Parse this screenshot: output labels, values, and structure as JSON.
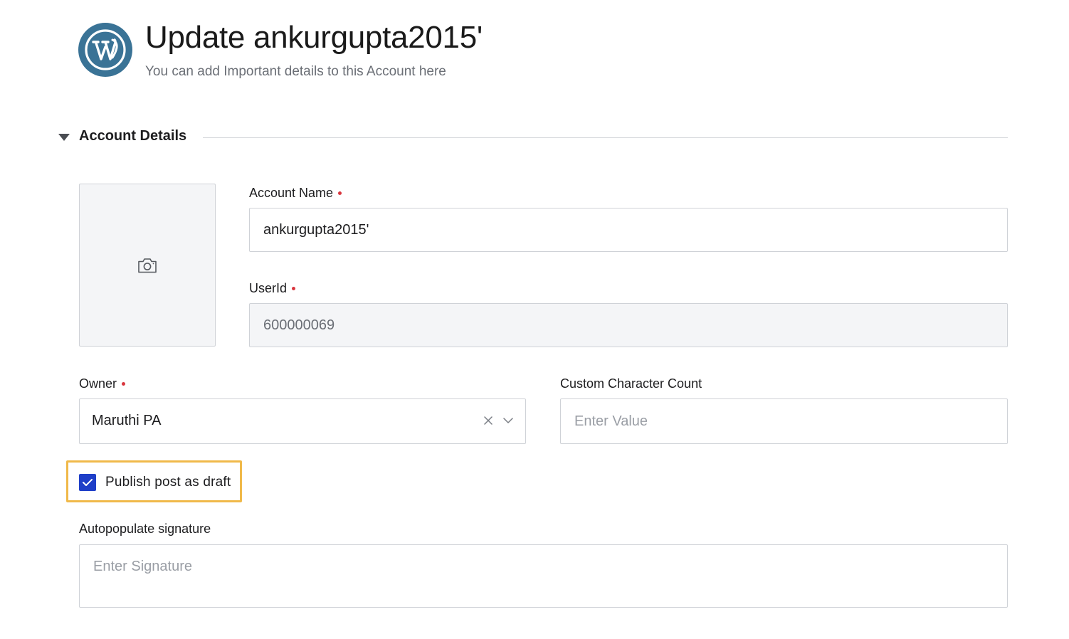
{
  "header": {
    "logo_icon": "wordpress-icon",
    "title": "Update ankurgupta2015'",
    "subtitle": "You can add Important details to this Account here"
  },
  "section": {
    "title": "Account Details",
    "expanded": true,
    "toggle_icon": "caret-down-icon"
  },
  "avatar": {
    "icon": "camera-icon"
  },
  "fields": {
    "account_name": {
      "label": "Account Name",
      "required": true,
      "value": "ankurgupta2015'"
    },
    "user_id": {
      "label": "UserId",
      "required": true,
      "value": "600000069",
      "readonly": true
    },
    "owner": {
      "label": "Owner",
      "required": true,
      "value": "Maruthi PA"
    },
    "custom_character_count": {
      "label": "Custom Character Count",
      "placeholder": "Enter Value",
      "value": ""
    },
    "publish_draft": {
      "label": "Publish post as draft",
      "checked": true
    },
    "signature": {
      "label": "Autopopulate signature",
      "placeholder": "Enter Signature",
      "value": ""
    }
  },
  "colors": {
    "logo_bg": "#3a7396",
    "checkbox": "#1f3fc8",
    "highlight": "#f0b94a",
    "required": "#d9363e"
  }
}
